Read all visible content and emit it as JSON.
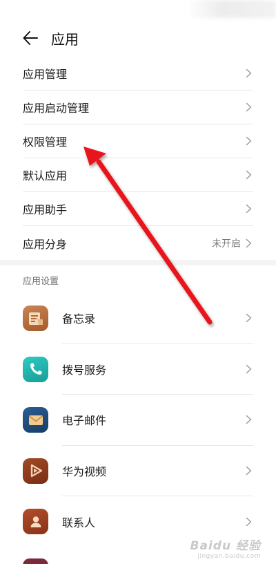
{
  "header": {
    "title": "应用"
  },
  "menu": {
    "items": [
      {
        "label": "应用管理"
      },
      {
        "label": "应用启动管理"
      },
      {
        "label": "权限管理"
      },
      {
        "label": "默认应用"
      },
      {
        "label": "应用助手"
      },
      {
        "label": "应用分身",
        "value": "未开启"
      }
    ]
  },
  "app_settings": {
    "title": "应用设置",
    "apps": [
      {
        "label": "备忘录",
        "icon": "memo-icon",
        "color": "#b06a3a"
      },
      {
        "label": "拨号服务",
        "icon": "phone-icon",
        "color": "#1fb8b0"
      },
      {
        "label": "电子邮件",
        "icon": "mail-icon",
        "color": "#1f4a78"
      },
      {
        "label": "华为视频",
        "icon": "video-play-icon",
        "color": "#8a3a1e"
      },
      {
        "label": "联系人",
        "icon": "contact-icon",
        "color": "#9a3b22"
      }
    ]
  },
  "annotation": {
    "arrow_color": "#e8141a"
  },
  "watermark": {
    "logo": "Baidu 经验",
    "url": "jingyan.baidu.com"
  }
}
